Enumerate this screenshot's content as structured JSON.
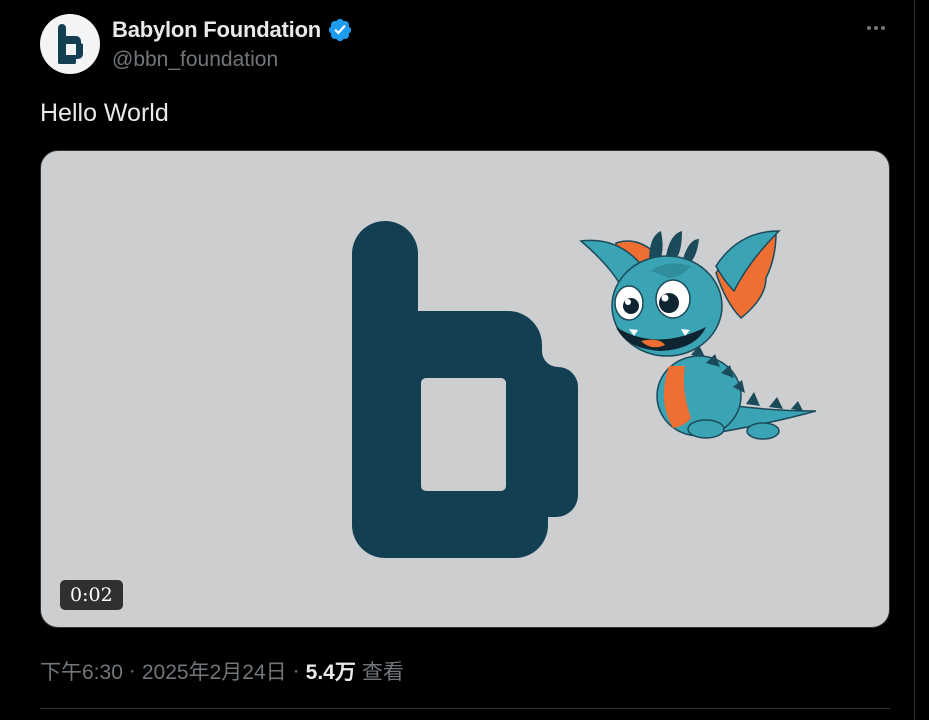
{
  "author": {
    "display_name": "Babylon Foundation",
    "handle": "@bbn_foundation",
    "verified": true,
    "verified_color": "#1d9bf0",
    "avatar_logo_color": "#123f52"
  },
  "tweet": {
    "text": "Hello World"
  },
  "media": {
    "type": "video",
    "duration": "0:02",
    "background_color": "#ccced0",
    "logo_color": "#123f52"
  },
  "meta": {
    "time": "下午6:30",
    "separator": "·",
    "date": "2025年2月24日",
    "views_count": "5.4万",
    "views_label": "查看"
  },
  "icons": {
    "more": "more-horizontal-icon",
    "verified": "verified-badge-icon"
  }
}
